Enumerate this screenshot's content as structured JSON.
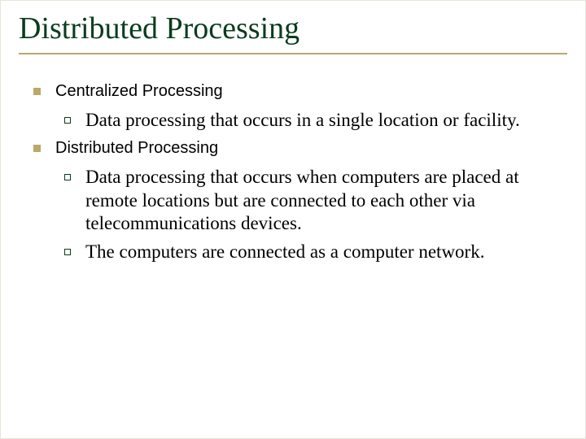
{
  "title": "Distributed Processing",
  "items": [
    {
      "label": "Centralized Processing",
      "sub": [
        "Data processing that occurs in a single location or facility."
      ]
    },
    {
      "label": "Distributed Processing",
      "sub": [
        "Data processing that occurs when computers are placed at remote locations but are connected to each other via telecommunications devices.",
        "The computers are connected as a computer network."
      ]
    }
  ]
}
